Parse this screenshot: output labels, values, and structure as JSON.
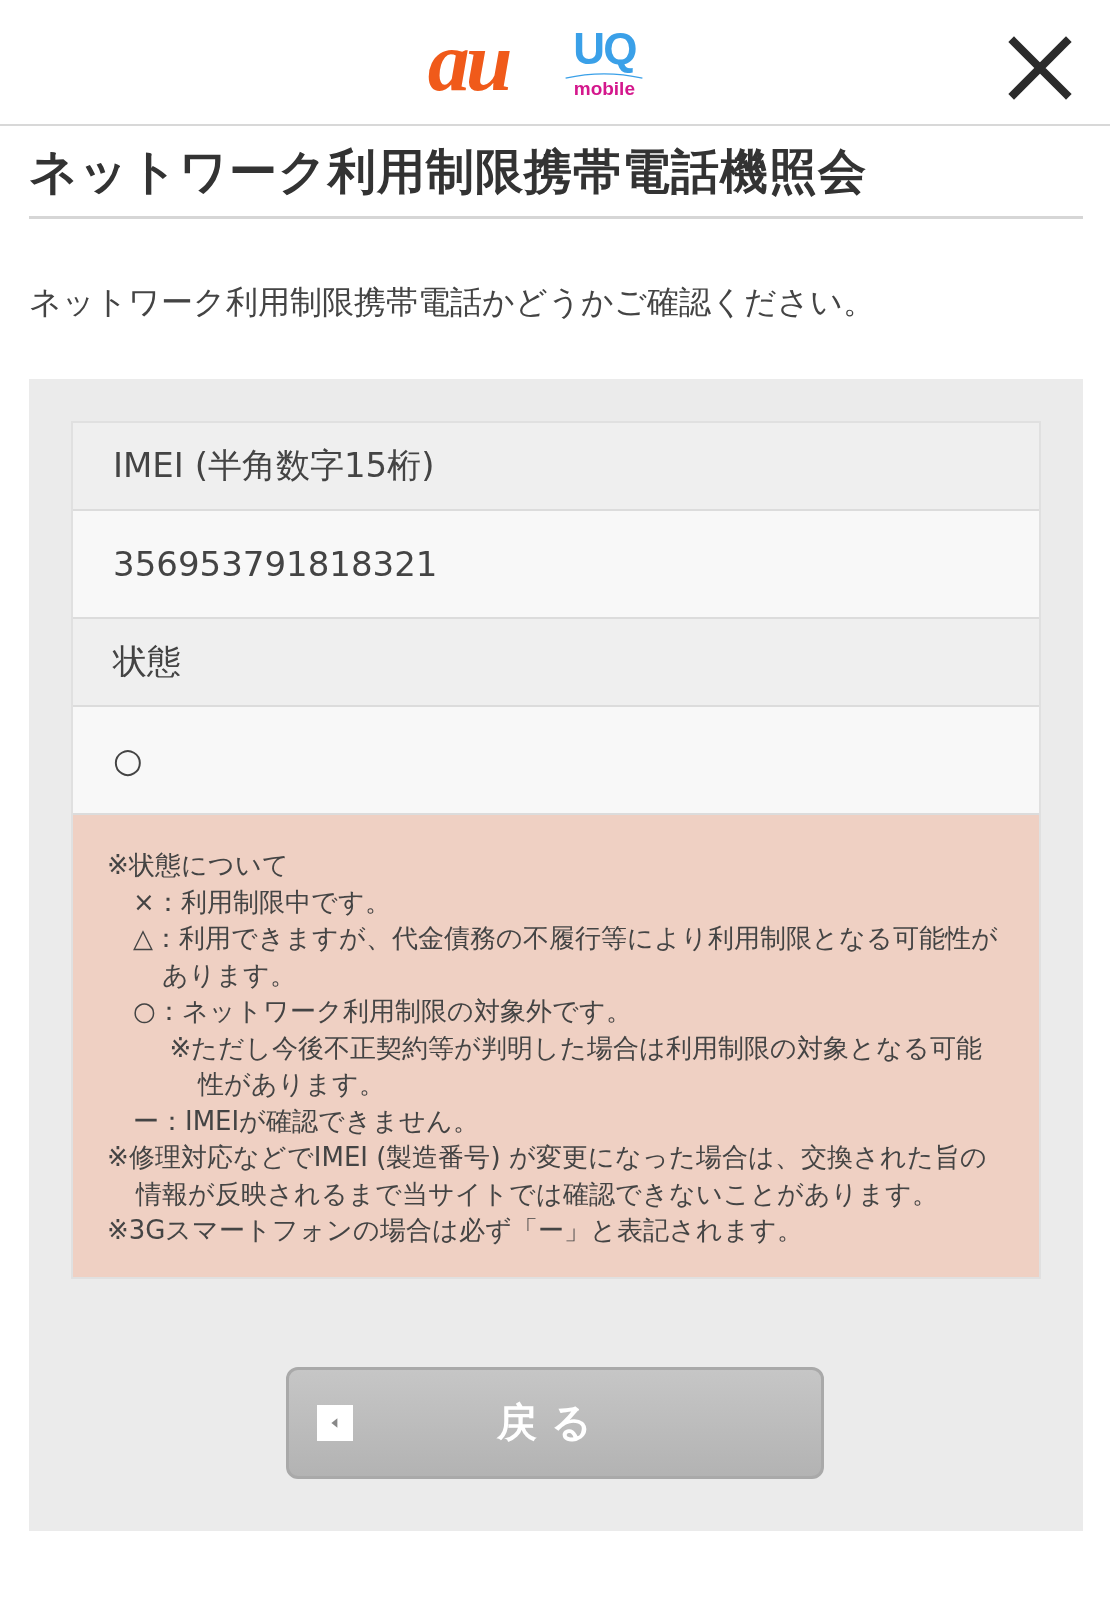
{
  "header": {
    "logos": [
      {
        "kind": "au",
        "text": "au"
      },
      {
        "kind": "uq",
        "text": "UQ",
        "sub": "mobile"
      }
    ]
  },
  "title": "ネットワーク利用制限携帯電話機照会",
  "lead": "ネットワーク利用制限携帯電話かどうかご確認ください。",
  "result": [
    {
      "kind": "label",
      "text": "IMEI (半角数字15桁)"
    },
    {
      "kind": "value",
      "text": "356953791818321"
    },
    {
      "kind": "label",
      "text": "状態"
    },
    {
      "kind": "value",
      "text": "○"
    }
  ],
  "notes": [
    {
      "text": "※状態について",
      "children": [
        {
          "text": "×：利用制限中です。"
        },
        {
          "text": "△：利用できますが、代金債務の不履行等により利用制限となる可能性があります。"
        },
        {
          "text": "○：ネットワーク利用制限の対象外です。",
          "children": [
            {
              "text": "※ただし今後不正契約等が判明した場合は利用制限の対象となる可能性があります。"
            }
          ]
        },
        {
          "text": "ー：IMEIが確認できません。"
        }
      ]
    },
    {
      "text": "※修理対応などでIMEI (製造番号) が変更になった場合は、交換された旨の情報が反映されるまで当サイトでは確認できないことがあります。"
    },
    {
      "text": "※3Gスマートフォンの場合は必ず「ー」と表記されます。"
    }
  ],
  "back_button": {
    "label": "戻る"
  }
}
